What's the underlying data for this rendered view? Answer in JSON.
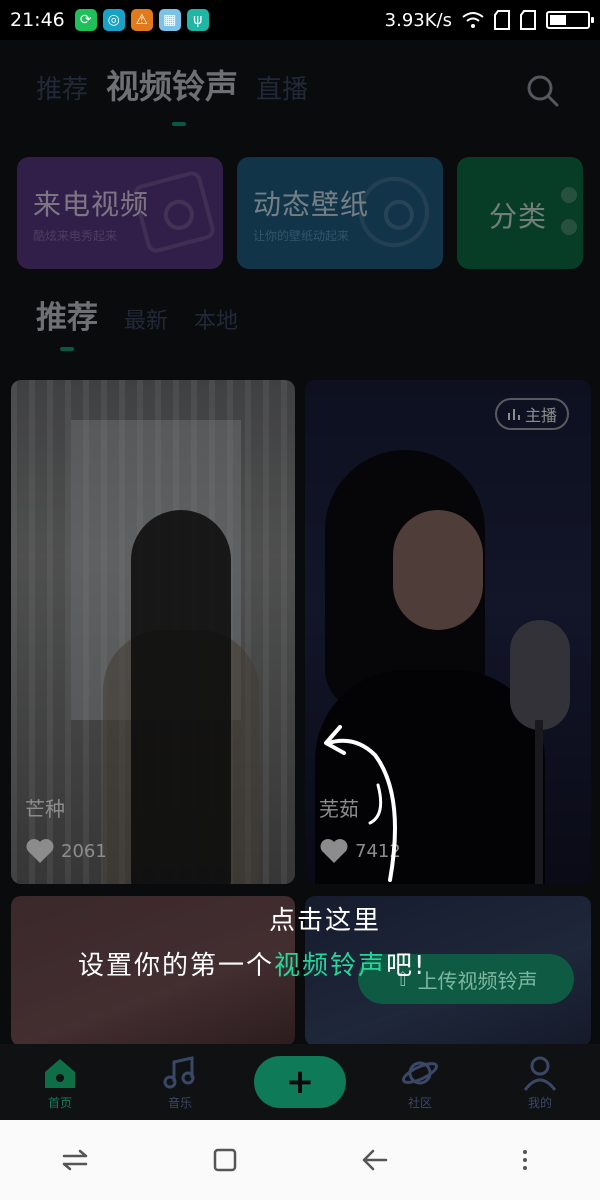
{
  "status_bar": {
    "time": "21:46",
    "net_speed": "3.93K/s",
    "battery_level": 0.4,
    "app_icons": [
      {
        "name": "sync-app-icon",
        "color": "#1fbf5a",
        "glyph": "⟳"
      },
      {
        "name": "browser-app-icon",
        "color": "#17a2c6",
        "glyph": "◎"
      },
      {
        "name": "warning-app-icon",
        "color": "#e07a1c",
        "glyph": "⚠"
      },
      {
        "name": "gallery-app-icon",
        "color": "#7cc2e6",
        "glyph": "▦"
      },
      {
        "name": "usb-app-icon",
        "color": "#1fb6a6",
        "glyph": "ψ"
      }
    ]
  },
  "top_tabs": [
    {
      "label": "推荐",
      "active": false
    },
    {
      "label": "视频铃声",
      "active": true
    },
    {
      "label": "直播",
      "active": false
    }
  ],
  "category_cards": {
    "call_video": {
      "title": "来电视频",
      "subtitle": "酷炫来电秀起来"
    },
    "live_wallpaper": {
      "title": "动态壁纸",
      "subtitle": "让你的壁纸动起来"
    },
    "category": {
      "title": "分类"
    }
  },
  "sub_tabs": [
    {
      "label": "推荐",
      "active": true
    },
    {
      "label": "最新",
      "active": false
    },
    {
      "label": "本地",
      "active": false
    }
  ],
  "videos": [
    {
      "title": "芒种",
      "likes": "2061"
    },
    {
      "title": "芜茹",
      "likes": "7412",
      "badge": "主播"
    }
  ],
  "guide": {
    "line1": "点击这里",
    "line2_prefix": "设置你的第一个",
    "line2_highlight": "视频铃声",
    "line2_suffix": "吧!"
  },
  "upload_button": {
    "label": "上传视频铃声"
  },
  "bottom_nav": [
    {
      "label": "首页",
      "icon": "home-icon",
      "active": true
    },
    {
      "label": "音乐",
      "icon": "music-icon",
      "active": false
    },
    {
      "label": "社区",
      "icon": "planet-icon",
      "active": false
    },
    {
      "label": "我的",
      "icon": "profile-icon",
      "active": false
    }
  ],
  "colors": {
    "accent": "#10a277",
    "highlight": "#25d69a",
    "card_purple": "#5b3a86",
    "card_blue": "#1f5f86",
    "card_green": "#0e6e46"
  }
}
